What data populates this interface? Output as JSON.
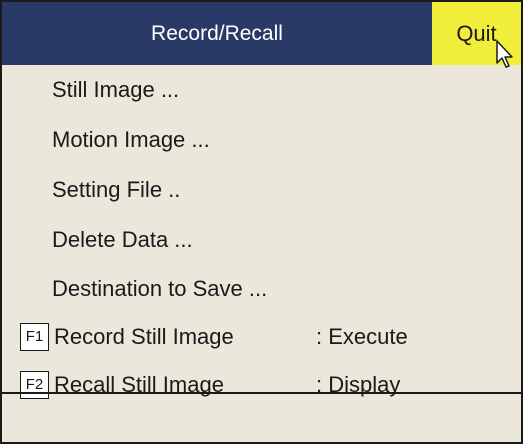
{
  "dialog": {
    "title": "Record/Recall",
    "quit_label": "Quit"
  },
  "menu": {
    "items": [
      {
        "label": "Still Image ..."
      },
      {
        "label": "Motion Image ..."
      },
      {
        "label": "Setting File .."
      },
      {
        "label": "Delete Data ..."
      },
      {
        "label": "Destination to Save ..."
      }
    ]
  },
  "function_keys": [
    {
      "key": "F1",
      "label": "Record Still Image",
      "value": ": Execute"
    },
    {
      "key": "F2",
      "label": "Recall Still Image",
      "value": ": Display"
    }
  ],
  "status": {
    "text": ""
  },
  "colors": {
    "titlebar": "#293a67",
    "quit_button": "#f1ee3b",
    "background": "#ebe7db"
  }
}
